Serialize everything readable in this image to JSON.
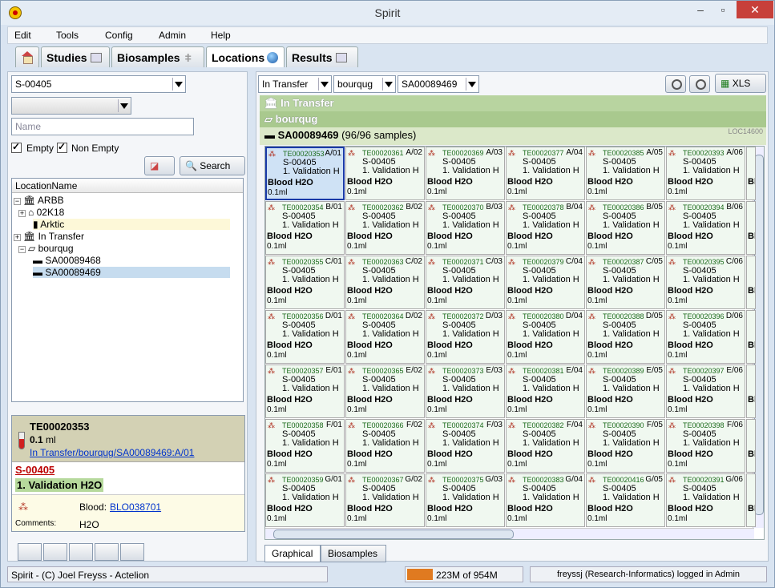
{
  "window": {
    "title": "Spirit"
  },
  "menu": [
    "Edit",
    "Tools",
    "Config",
    "Admin",
    "Help"
  ],
  "tabs": [
    {
      "label": "Studies",
      "icon": "studies-icon"
    },
    {
      "label": "Biosamples",
      "icon": "dna-icon"
    },
    {
      "label": "Locations",
      "icon": "globe-icon"
    },
    {
      "label": "Results",
      "icon": "table-icon"
    }
  ],
  "left": {
    "study_combo": "S-00405",
    "type_combo": "",
    "name_placeholder": "Name",
    "empty_label": "Empty",
    "nonempty_label": "Non Empty",
    "search_label": "Search",
    "tree_header": "LocationName",
    "tree": [
      "ARBB",
      "02K18",
      "Arktic",
      "In Transfer",
      "bourqug",
      "SA00089468",
      "SA00089469"
    ]
  },
  "detail": {
    "id": "TE00020353",
    "amount": "0.1",
    "unit": "ml",
    "path": "In Transfer/bourqug/SA00089469:A/01",
    "study": "S-00405",
    "group": "1. Validation H2O",
    "biotype_label": "Blood:",
    "biotype_link": "BLO038701",
    "comments_label": "Comments:",
    "comments": "H2O"
  },
  "right": {
    "crumb1": "In Transfer",
    "crumb2": "bourqug",
    "crumb3": "SA00089469",
    "xls_label": "XLS",
    "row_in_transfer": "In Transfer",
    "row_bourqug": "bourqug",
    "container_name": "SA00089469",
    "container_count": "(96/96 samples)",
    "container_code": "LOC14600",
    "bottom_tab_graphical": "Graphical",
    "bottom_tab_biosamples": "Biosamples"
  },
  "grid": {
    "columns": [
      {
        "col": "01",
        "ids": [
          "TE00020353",
          "TE00020354",
          "TE00020355",
          "TE00020356",
          "TE00020357",
          "TE00020358",
          "TE00020359"
        ]
      },
      {
        "col": "02",
        "ids": [
          "TE00020361",
          "TE00020362",
          "TE00020363",
          "TE00020364",
          "TE00020365",
          "TE00020366",
          "TE00020367"
        ]
      },
      {
        "col": "03",
        "ids": [
          "TE00020369",
          "TE00020370",
          "TE00020371",
          "TE00020372",
          "TE00020373",
          "TE00020374",
          "TE00020375"
        ]
      },
      {
        "col": "04",
        "ids": [
          "TE00020377",
          "TE00020378",
          "TE00020379",
          "TE00020380",
          "TE00020381",
          "TE00020382",
          "TE00020383"
        ]
      },
      {
        "col": "05",
        "ids": [
          "TE00020385",
          "TE00020386",
          "TE00020387",
          "TE00020388",
          "TE00020389",
          "TE00020390",
          "TE00020416"
        ]
      },
      {
        "col": "06",
        "ids": [
          "TE00020393",
          "TE00020394",
          "TE00020395",
          "TE00020396",
          "TE00020397",
          "TE00020398",
          "TE00020391"
        ]
      }
    ],
    "rows": [
      "A",
      "B",
      "C",
      "D",
      "E",
      "F",
      "G"
    ],
    "study": "S-00405",
    "group": "1. Validation H",
    "type": "Blood H2O",
    "amount": "0.1ml",
    "partial_type": "Bl"
  },
  "status": {
    "left": "Spirit - (C) Joel Freyss - Actelion",
    "memory": "223M of 954M",
    "user": "freyssj (Research-Informatics) logged in Admin"
  }
}
